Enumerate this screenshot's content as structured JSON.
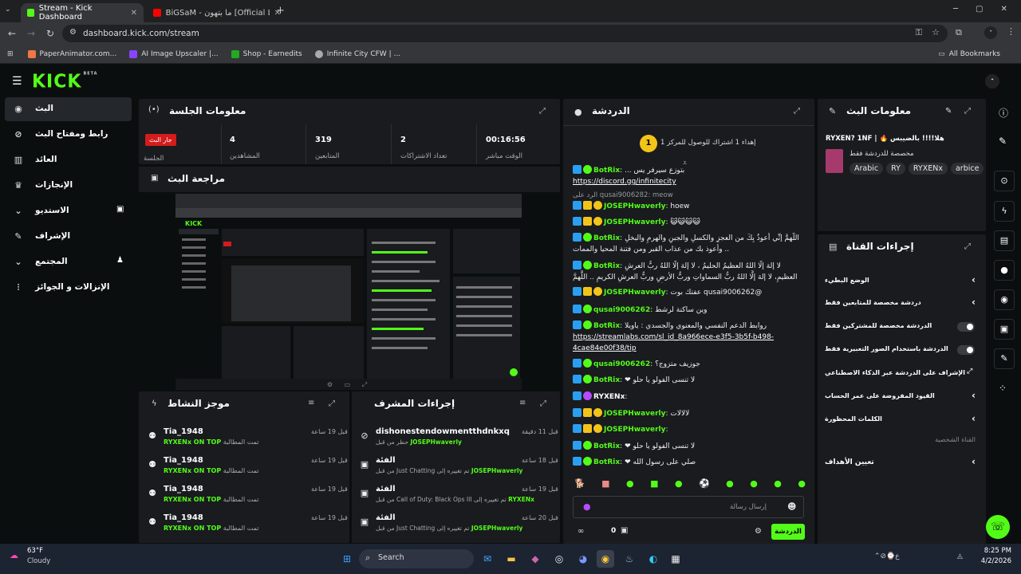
{
  "browser": {
    "tabs": [
      {
        "title": "Stream - Kick Dashboard",
        "active": true
      },
      {
        "title": "BiGSaM - ما بتهون [Official Lyric",
        "active": false
      }
    ],
    "url": "dashboard.kick.com/stream",
    "bookmarks": [
      "PaperAnimator.com...",
      "AI Image Upscaler |...",
      "Shop - Earnedits",
      "Infinite City CFW | ..."
    ],
    "all_bookmarks": "All Bookmarks"
  },
  "kick": {
    "logo": "KICK",
    "logo_tag": "BETA"
  },
  "sidebar": {
    "items": [
      {
        "label": "البث",
        "icon": "broadcast-icon"
      },
      {
        "label": "رابط ومفتاح البث",
        "icon": "link-icon"
      },
      {
        "label": "العائد",
        "icon": "revenue-icon"
      },
      {
        "label": "الإنجازات",
        "icon": "trophy-icon"
      },
      {
        "label": "الاستديو",
        "icon": "studio-icon"
      },
      {
        "label": "الإشراف",
        "icon": "wrench-icon"
      },
      {
        "label": "المجتمع",
        "icon": "community-icon"
      },
      {
        "label": "الإنزالات و الجوائز",
        "icon": "drops-icon"
      }
    ]
  },
  "session": {
    "title": "معلومات الجلسة",
    "live_badge": "جار البث",
    "live_label": "الجلسة",
    "stats": [
      {
        "value": "4",
        "label": "المشاهدين"
      },
      {
        "value": "319",
        "label": "المتابعين"
      },
      {
        "value": "2",
        "label": "تعداد الاشتراكات"
      },
      {
        "value": "00:16:56",
        "label": "الوقت مباشر"
      }
    ]
  },
  "preview": {
    "title": "مراجعة البث"
  },
  "activity": {
    "title": "موجز النشاط",
    "items": [
      {
        "name": "Tia_1948",
        "prefix": "تمت المطالبة",
        "reward": "RYXENx ON TOP",
        "time": "قبل 19 ساعة"
      },
      {
        "name": "Tia_1948",
        "prefix": "تمت المطالبة",
        "reward": "RYXENx ON TOP",
        "time": "قبل 19 ساعة"
      },
      {
        "name": "Tia_1948",
        "prefix": "تمت المطالبة",
        "reward": "RYXENx ON TOP",
        "time": "قبل 19 ساعة"
      },
      {
        "name": "Tia_1948",
        "prefix": "تمت المطالبة",
        "reward": "RYXENx ON TOP",
        "time": "قبل 19 ساعة"
      }
    ]
  },
  "modactions": {
    "title": "إجراءات المشرف",
    "items": [
      {
        "title": "dishonestendowmentthdnkxq",
        "sub": "حظر من قبل",
        "by": "JOSEPHwaverly",
        "time": "قبل 11 دقيقة",
        "icon": "ban-icon"
      },
      {
        "title": "الفئة",
        "sub": "تم تغييره إلى Just Chatting من قبل",
        "by": "JOSEPHwaverly",
        "time": "قبل 18 ساعة",
        "icon": "category-icon"
      },
      {
        "title": "الفئة",
        "sub": "تم تغييره إلى Call of Duty: Black Ops III من قبل",
        "by": "RYXENx",
        "time": "قبل 19 ساعة",
        "icon": "category-icon"
      },
      {
        "title": "الفئة",
        "sub": "تم تغييره إلى Just Chatting من قبل",
        "by": "JOSEPHwaverly",
        "time": "قبل 20 ساعة",
        "icon": "category-icon"
      }
    ]
  },
  "chat": {
    "title": "الدردشة",
    "goal": "إهداء 1 اشتراك للوصول للمركز 1",
    "goal_num": "1",
    "messages": [
      {
        "user": "BotRix",
        "color": "green",
        "text": "بتوزع سيرفر يس ..."
      },
      {
        "user": "",
        "color": "",
        "text": "https://discord.gg/infinitecity",
        "link": true
      },
      {
        "user": "",
        "color": "",
        "text": "الرد على qusai9006282: meow",
        "reply": true
      },
      {
        "user": "JOSEPHwaverly",
        "color": "green",
        "text": "hoew"
      },
      {
        "user": "JOSEPHwaverly",
        "color": "green",
        "text": "😺😺😺😺"
      },
      {
        "user": "BotRix",
        "color": "green",
        "text": "اللَّهمَّ إنِّي أعوذُ بِكَ من العجزِ والكسلِ والجبنِ والهرمِ والبخلِ .. وأعوذ بك من عذاب القبر ومن فتنة المحيا والممات"
      },
      {
        "user": "BotRix",
        "color": "green",
        "text": "لا إلهَ إلَّا اللهُ العظيمُ الحليمُ ، لا إلهَ إلَّا اللهُ ربُّ العرشِ العظيمِ، لا إلهَ إلَّا اللهُ ربُّ السماواتِ وربُّ الأرضِ وربُّ العرشِ الكريمِ .. اللَّهمَّ إنِّي أسألك الجنة وأستجير بك من النار"
      },
      {
        "user": "JOSEPHwaverly",
        "color": "green",
        "text": "@qusai9006262 عفتك بوت"
      },
      {
        "user": "qusai9006262",
        "color": "green",
        "text": "وين ساكنة لرشط"
      },
      {
        "user": "BotRix",
        "color": "green",
        "text": "روابط الدعم النفسي والمعنوي والجسدي : ياويلا"
      },
      {
        "user": "",
        "color": "",
        "text": "https://streamlabs.com/sl_id_8a966ece-e3f5-3b5f-b498-4cae84e00f38/tip",
        "link": true
      },
      {
        "user": "qusai9006262",
        "color": "green",
        "text": "جوزيف متزوج؟"
      },
      {
        "user": "BotRix",
        "color": "green",
        "text": "لا تنسى الفولو يا حلو ❤"
      },
      {
        "user": "RYXENx",
        "color": "white",
        "text": ""
      },
      {
        "user": "JOSEPHwaverly",
        "color": "green",
        "text": "لالالات"
      },
      {
        "user": "JOSEPHwaverly",
        "color": "green",
        "text": ""
      },
      {
        "user": "BotRix",
        "color": "green",
        "text": "لا تنسى الفولو يا حلو ❤"
      },
      {
        "user": "BotRix",
        "color": "green",
        "text": "صلي على رسول الله ❤"
      }
    ],
    "input_placeholder": "إرسال رسالة",
    "send_label": "الدردشة",
    "viewers": "0"
  },
  "streaminfo": {
    "title": "معلومات البث",
    "stream_title": "هلا!!!! بالضيبس 🔥 | RYXEN? 1NF",
    "category": "مخصصة للدردشة فقط",
    "tags": [
      "Arabic",
      "RY",
      "RYXENx",
      "arbice"
    ]
  },
  "channel_actions": {
    "title": "إجراءات القناة",
    "rows": [
      {
        "label": "الوضع البطيء",
        "type": "chevron"
      },
      {
        "label": "دردشة مخصصة للمتابعين فقط",
        "type": "chevron"
      },
      {
        "label": "الدردشة مخصصة للمشتركين فقط",
        "type": "toggle"
      },
      {
        "label": "الدردشة باستخدام الصور التعبيرية فقط",
        "type": "toggle"
      },
      {
        "label": "الإشراف على الدردشة عبر الذكاء الاصطناعي",
        "type": "external"
      },
      {
        "label": "القيود المفروضة على عمر الحساب",
        "type": "chevron"
      },
      {
        "label": "الكلمات المحظورة",
        "type": "chevron"
      }
    ],
    "section": "القناة الشخصية",
    "target_label": "تعيين الأهداف"
  },
  "taskbar": {
    "weather_temp": "63°F",
    "weather_desc": "Cloudy",
    "search": "Search",
    "time": "8:25 PM",
    "date": "4/2/2026"
  },
  "colors": {
    "accent": "#53fc18",
    "panel": "#191b1f",
    "bg": "#0b0e0f",
    "live": "#d41c1c"
  }
}
